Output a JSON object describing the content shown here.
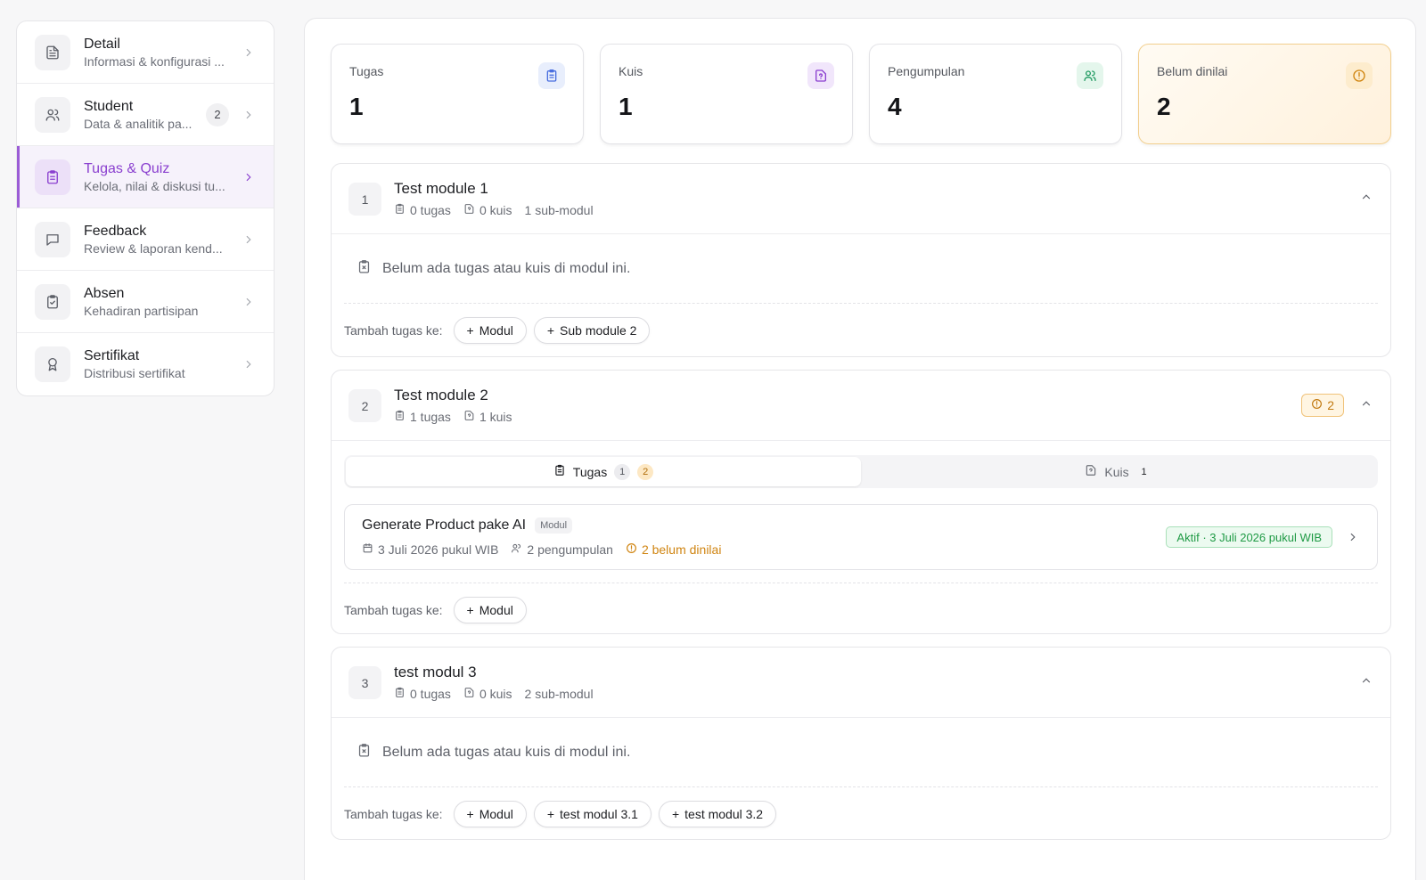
{
  "sidebar": {
    "items": [
      {
        "title": "Detail",
        "sub": "Informasi & konfigurasi ...",
        "count": "",
        "icon": "document-icon"
      },
      {
        "title": "Student",
        "sub": "Data & analitik pa...",
        "count": "2",
        "icon": "users-icon"
      },
      {
        "title": "Tugas & Quiz",
        "sub": "Kelola, nilai & diskusi tu...",
        "count": "",
        "icon": "clipboard-icon"
      },
      {
        "title": "Feedback",
        "sub": "Review & laporan kend...",
        "count": "",
        "icon": "message-icon"
      },
      {
        "title": "Absen",
        "sub": "Kehadiran partisipan",
        "count": "",
        "icon": "clipboard-check-icon"
      },
      {
        "title": "Sertifikat",
        "sub": "Distribusi sertifikat",
        "count": "",
        "icon": "award-icon"
      }
    ]
  },
  "stats": [
    {
      "label": "Tugas",
      "value": "1",
      "icon": "clipboard-icon",
      "color": "#4a6fe0",
      "bg": "#e8eefc"
    },
    {
      "label": "Kuis",
      "value": "1",
      "icon": "file-question-icon",
      "color": "#8b3fd0",
      "bg": "#f1e6fb"
    },
    {
      "label": "Pengumpulan",
      "value": "4",
      "icon": "users-icon",
      "color": "#1f9a60",
      "bg": "#e4f6ec"
    },
    {
      "label": "Belum dinilai",
      "value": "2",
      "icon": "alert-circle-icon",
      "color": "#d0840e",
      "bg": "#fdeccd"
    }
  ],
  "modules": {
    "m1": {
      "num": "1",
      "title": "Test module 1",
      "tugas": "0 tugas",
      "kuis": "0 kuis",
      "sub": "1 sub-modul",
      "empty": "Belum ada tugas atau kuis di modul ini.",
      "add_label": "Tambah tugas ke:",
      "buttons": [
        "Modul",
        "Sub module 2"
      ]
    },
    "m2": {
      "num": "2",
      "title": "Test module 2",
      "tugas": "1 tugas",
      "kuis": "1 kuis",
      "warn_count": "2",
      "tabs": {
        "tugas": "Tugas",
        "tugas_count": "1",
        "tugas_warn": "2",
        "kuis": "Kuis",
        "kuis_count": "1"
      },
      "task": {
        "title": "Generate Product pake AI",
        "tag": "Modul",
        "date": "3 Juli 2026 pukul WIB",
        "submissions": "2 pengumpulan",
        "ungraded": "2 belum dinilai",
        "status": "Aktif · 3 Juli 2026 pukul WIB"
      },
      "add_label": "Tambah tugas ke:",
      "buttons": [
        "Modul"
      ]
    },
    "m3": {
      "num": "3",
      "title": "test modul 3",
      "tugas": "0 tugas",
      "kuis": "0 kuis",
      "sub": "2 sub-modul",
      "empty": "Belum ada tugas atau kuis di modul ini.",
      "add_label": "Tambah tugas ke:",
      "buttons": [
        "Modul",
        "test modul 3.1",
        "test modul 3.2"
      ]
    }
  }
}
